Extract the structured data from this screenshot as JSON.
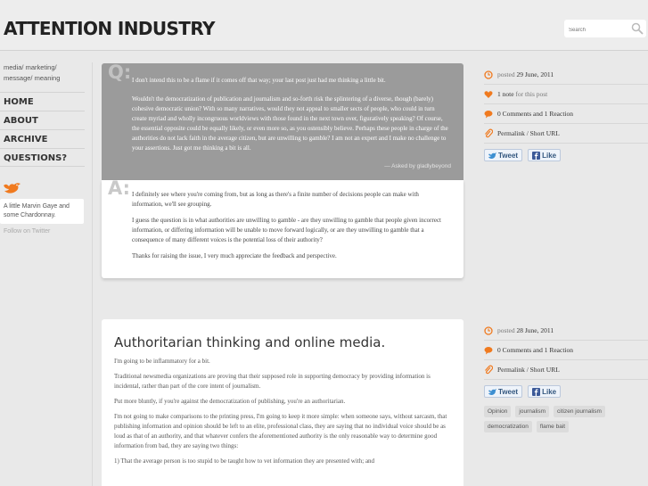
{
  "site": {
    "title": "ATTENTION INDUSTRY"
  },
  "search": {
    "placeholder": "Search"
  },
  "sidebar": {
    "tagline": "media/ marketing/ message/ meaning",
    "nav": [
      "HOME",
      "ABOUT",
      "ARCHIVE",
      "QUESTIONS?"
    ],
    "tweet": "A little Marvin Gaye and some Chardonnay.",
    "follow": "Follow on Twitter"
  },
  "post1": {
    "q_letter": "Q:",
    "question": [
      "I don't intend this to be a flame if it comes off that way; your last post just had me thinking a little bit.",
      "Wouldn't the democratization of publication and journalism and so-forth risk the splintering of a diverse, though (barely) cohesive democratic union? With so many narratives, would they not appeal to smaller sects of people, who could in turn create myriad and wholly incongruous worldviews with those found in the next town over, figuratively speaking? Of course, the essential opposite could be equally likely, or even more so, as you ostensibly believe. Perhaps these people in charge of the authorities do not lack faith in the average citizen, but are unwilling to gamble? I am not an expert and I make no challenge to your assertions. Just got me thinking a bit is all."
    ],
    "asked_by": "— Asked by gladlybeyond",
    "a_letter": "A:",
    "answer": [
      "I definitely see where you're coming from, but as long as there's a finite number of decisions people can make with information, we'll see grouping.",
      "I guess the question is in what authorities are unwilling to gamble - are they unwilling to gamble that people given incorrect information, or differing information will be unable to move forward logically, or are they unwilling to gamble that a consequence of many different voices is the potential loss of their authority?",
      "Thanks for raising the issue, I very much appreciate the feedback and perspective."
    ]
  },
  "meta1": {
    "posted_label": "posted",
    "date": "29 June, 2011",
    "note_count": "1 note",
    "note_suffix": "for this post",
    "comments": "0 Comments and 1 Reaction",
    "permalink": "Permalink",
    "short_url": "Short URL",
    "tweet_btn": "Tweet",
    "like_btn": "Like"
  },
  "post2": {
    "title": "Authoritarian thinking and online media.",
    "paragraphs": [
      "I'm going to be inflammatory for a bit.",
      "Traditional newsmedia organizations are proving that their supposed role in supporting democracy by providing information is incidental, rather than part of the core intent of journalism.",
      "Put more bluntly, if you're against the democratization of publishing, you're an authoritarian.",
      "I'm not going to make comparisons to the printing press, I'm going to keep it more simple: when someone says, without sarcasm, that publishing information and opinion should be left to an elite, professional class, they are saying that no individual voice should be as loud as that of an authority, and that whatever confers the aforementioned authority is the only reasonable way to determine good information from bad, they are saying two things:",
      "1) That the average person is too stupid to be taught how to vet information they are presented with; and"
    ]
  },
  "meta2": {
    "posted_label": "posted",
    "date": "28 June, 2011",
    "comments": "0 Comments and 1 Reaction",
    "permalink": "Permalink",
    "short_url": "Short URL",
    "tweet_btn": "Tweet",
    "like_btn": "Like",
    "tags": [
      "Opinion",
      "journalism",
      "citizen journalism",
      "democratization",
      "flame bait"
    ]
  },
  "colors": {
    "accent": "#f07a1f",
    "question_bg": "#9b9b9b",
    "page_bg": "#e9e9e9"
  }
}
